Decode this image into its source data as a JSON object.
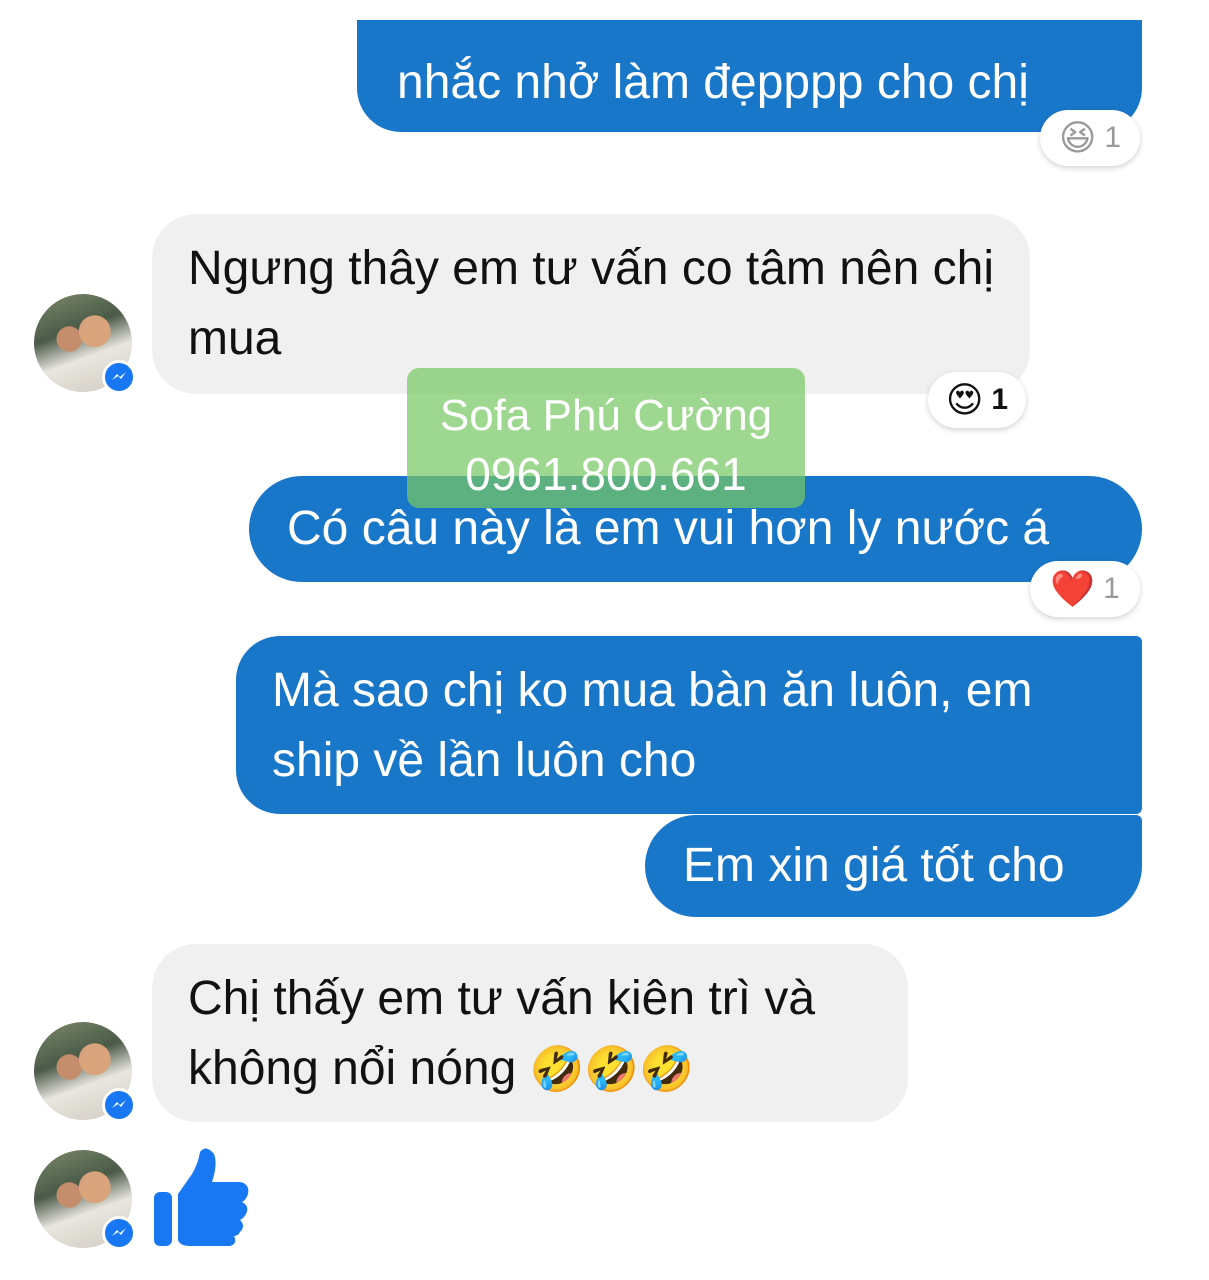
{
  "messages": [
    {
      "text": "nhắc nhở làm đẹpppp cho chị",
      "reaction": {
        "emoji": "😆",
        "count": "1"
      }
    },
    {
      "text": "Ngưng thây em tư vấn co tâm nên chị mua",
      "reaction": {
        "emoji": "😍",
        "count": "1"
      }
    },
    {
      "text": "Có câu này là em vui hơn ly nước á",
      "reaction": {
        "emoji": "❤️",
        "count": "1"
      }
    },
    {
      "text": "Mà sao chị ko mua bàn ăn luôn, em ship về lần luôn cho"
    },
    {
      "text": "Em xin giá tốt cho"
    },
    {
      "text": "Chị thấy em tư vấn kiên trì và không nổi nóng",
      "emoji": "🤣🤣🤣"
    }
  ],
  "watermark": {
    "line1": "Sofa Phú Cường",
    "line2": "0961.800.661"
  },
  "icons": {
    "like": "thumbs-up-icon",
    "badge": "messenger-icon"
  },
  "colors": {
    "outgoing": "#1877c9",
    "incoming": "#f1f0f0",
    "like": "#1877f2"
  }
}
